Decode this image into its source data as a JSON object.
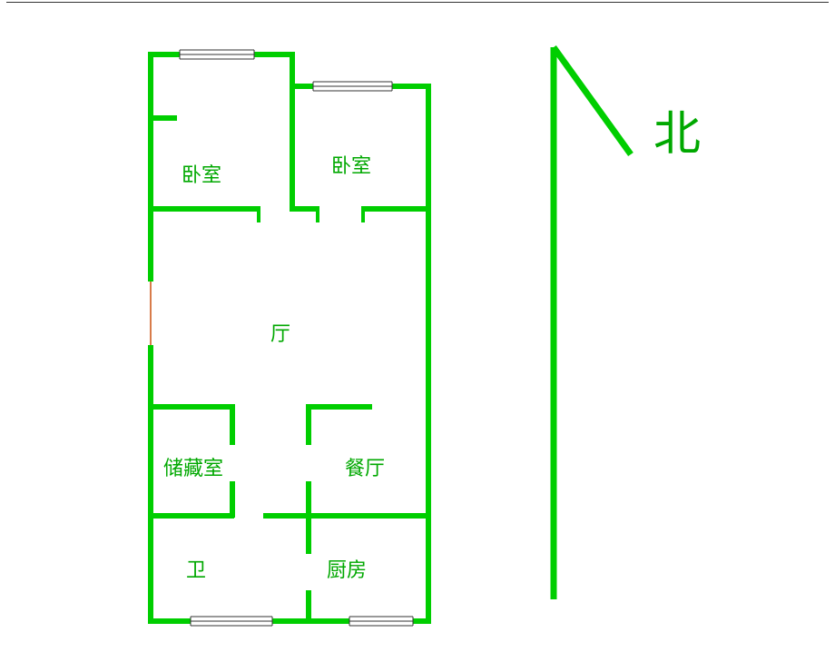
{
  "rooms": {
    "bedroom_left": "卧室",
    "bedroom_right": "卧室",
    "living": "厅",
    "storage": "储藏室",
    "dining": "餐厅",
    "bathroom": "卫",
    "kitchen": "厨房"
  },
  "compass": {
    "north": "北"
  }
}
